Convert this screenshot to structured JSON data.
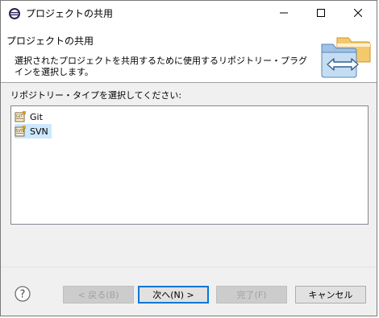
{
  "window": {
    "title": "プロジェクトの共用"
  },
  "banner": {
    "title": "プロジェクトの共用",
    "description": "選択されたプロジェクトを共用するために使用するリポジトリー・プラグインを選択します。"
  },
  "content": {
    "list_label": "リポジトリー・タイプを選択してください:",
    "repository_types": [
      {
        "label": "Git",
        "icon": "git-repo-icon",
        "selected": false
      },
      {
        "label": "SVN",
        "icon": "svn-repo-icon",
        "selected": true
      }
    ]
  },
  "buttons": {
    "back": "< 戻る(B)",
    "next": "次へ(N) >",
    "finish": "完了(F)",
    "cancel": "キャンセル"
  },
  "colors": {
    "selection": "#cce8ff",
    "default_button_border": "#0078d7",
    "dialog_background": "#f0f0f0"
  }
}
